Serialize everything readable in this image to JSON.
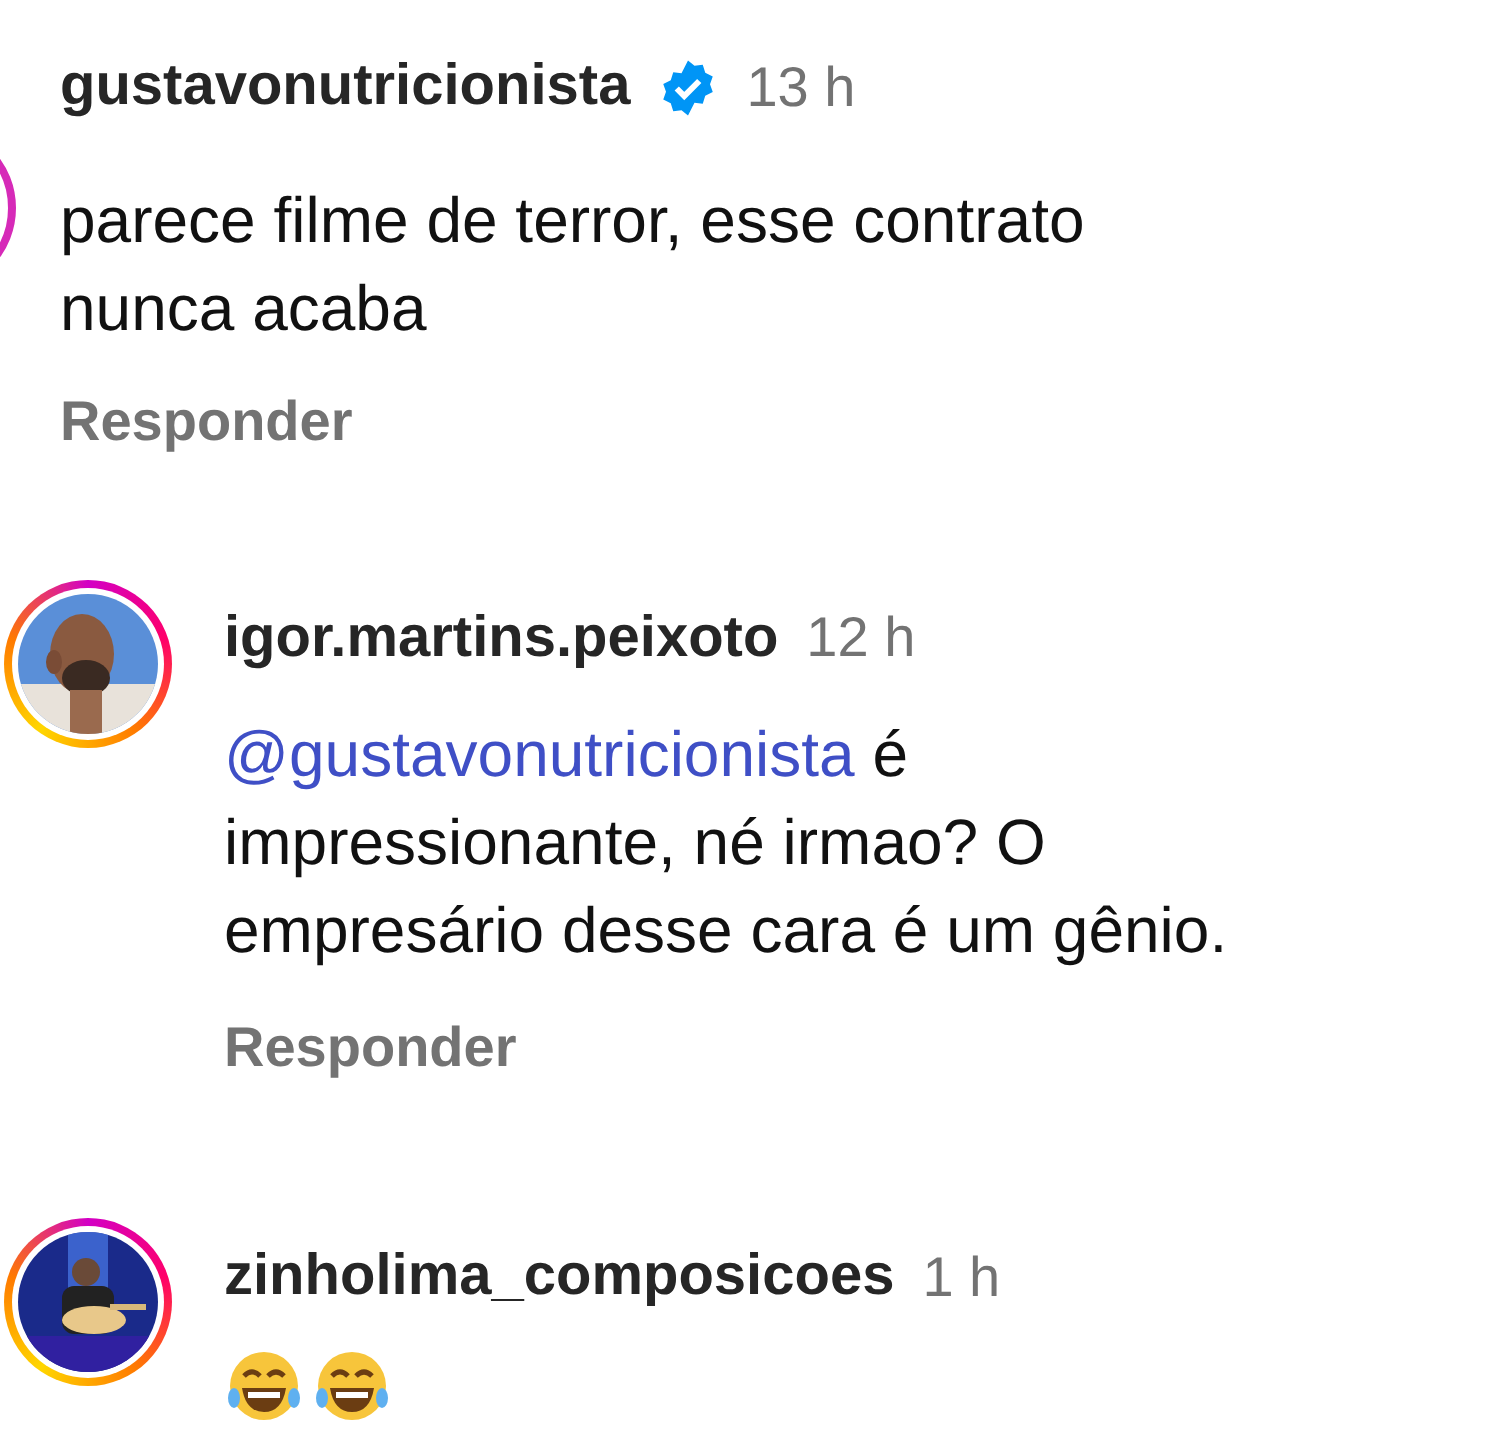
{
  "comment": {
    "username": "gustavonutricionista",
    "verified": true,
    "time": "13 h",
    "text": "parece filme de terror, esse contrato nunca acaba",
    "reply_label": "Responder"
  },
  "replies": [
    {
      "username": "igor.martins.peixoto",
      "time": "12 h",
      "mention": "@gustavonutricionista",
      "text": " é impressionante, né irmao? O empresário desse cara é um gênio.",
      "reply_label": "Responder"
    },
    {
      "username": "zinholima_composicoes",
      "time": "1 h",
      "emojis": [
        {
          "kind": "laughing"
        },
        {
          "kind": "laughing"
        }
      ]
    }
  ]
}
